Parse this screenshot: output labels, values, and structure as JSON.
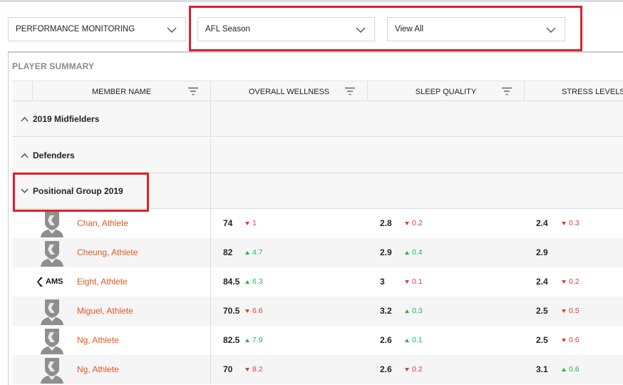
{
  "filters": [
    {
      "value": "PERFORMANCE MONITORING"
    },
    {
      "value": "AFL Season"
    },
    {
      "value": "View All"
    }
  ],
  "section_title": "PLAYER SUMMARY",
  "columns": [
    "MEMBER NAME",
    "OVERALL WELLNESS",
    "SLEEP QUALITY",
    "STRESS LEVELS"
  ],
  "groups": [
    {
      "label": "2019 Midfielders",
      "state": "collapsed"
    },
    {
      "label": "Defenders",
      "state": "collapsed"
    },
    {
      "label": "Positional Group 2019",
      "state": "expanded"
    }
  ],
  "rows": [
    {
      "name": "Chan, Athlete",
      "avatar": "shield-avatar",
      "wellness": "74",
      "wellness_delta": "1",
      "wellness_dir": "down",
      "sleep": "2.8",
      "sleep_delta": "0.2",
      "sleep_dir": "down",
      "stress": "2.4",
      "stress_delta": "0.3",
      "stress_dir": "down"
    },
    {
      "name": "Cheung, Athlete",
      "avatar": "shield-avatar",
      "wellness": "82",
      "wellness_delta": "4.7",
      "wellness_dir": "up",
      "sleep": "2.9",
      "sleep_delta": "0.4",
      "sleep_dir": "up",
      "stress": "2.9",
      "stress_delta": "",
      "stress_dir": ""
    },
    {
      "name": "Eight, Athlete",
      "avatar": "ams-logo",
      "logo_text": "AMS",
      "wellness": "84.5",
      "wellness_delta": "6.3",
      "wellness_dir": "up",
      "sleep": "3",
      "sleep_delta": "0.1",
      "sleep_dir": "down",
      "stress": "2.4",
      "stress_delta": "0.2",
      "stress_dir": "down"
    },
    {
      "name": "Miguel, Athlete",
      "avatar": "shield-avatar",
      "wellness": "70.5",
      "wellness_delta": "6.6",
      "wellness_dir": "down",
      "sleep": "3.2",
      "sleep_delta": "0.3",
      "sleep_dir": "up",
      "stress": "2.5",
      "stress_delta": "0.5",
      "stress_dir": "down"
    },
    {
      "name": "Ng, Athlete",
      "avatar": "shield-avatar",
      "wellness": "82.5",
      "wellness_delta": "7.9",
      "wellness_dir": "up",
      "sleep": "2.6",
      "sleep_delta": "0.1",
      "sleep_dir": "up",
      "stress": "2.5",
      "stress_delta": "0.6",
      "stress_dir": "down"
    },
    {
      "name": "Ng, Athlete",
      "avatar": "shield-avatar",
      "wellness": "70",
      "wellness_delta": "8.2",
      "wellness_dir": "down",
      "sleep": "2.6",
      "sleep_delta": "0.2",
      "sleep_dir": "down",
      "stress": "3.1",
      "stress_delta": "0.6",
      "stress_dir": "up"
    }
  ],
  "colors": {
    "highlight": "#d9212c",
    "name_link": "#e2571e",
    "delta_down": "#e03a3a",
    "delta_up": "#22b24c"
  }
}
